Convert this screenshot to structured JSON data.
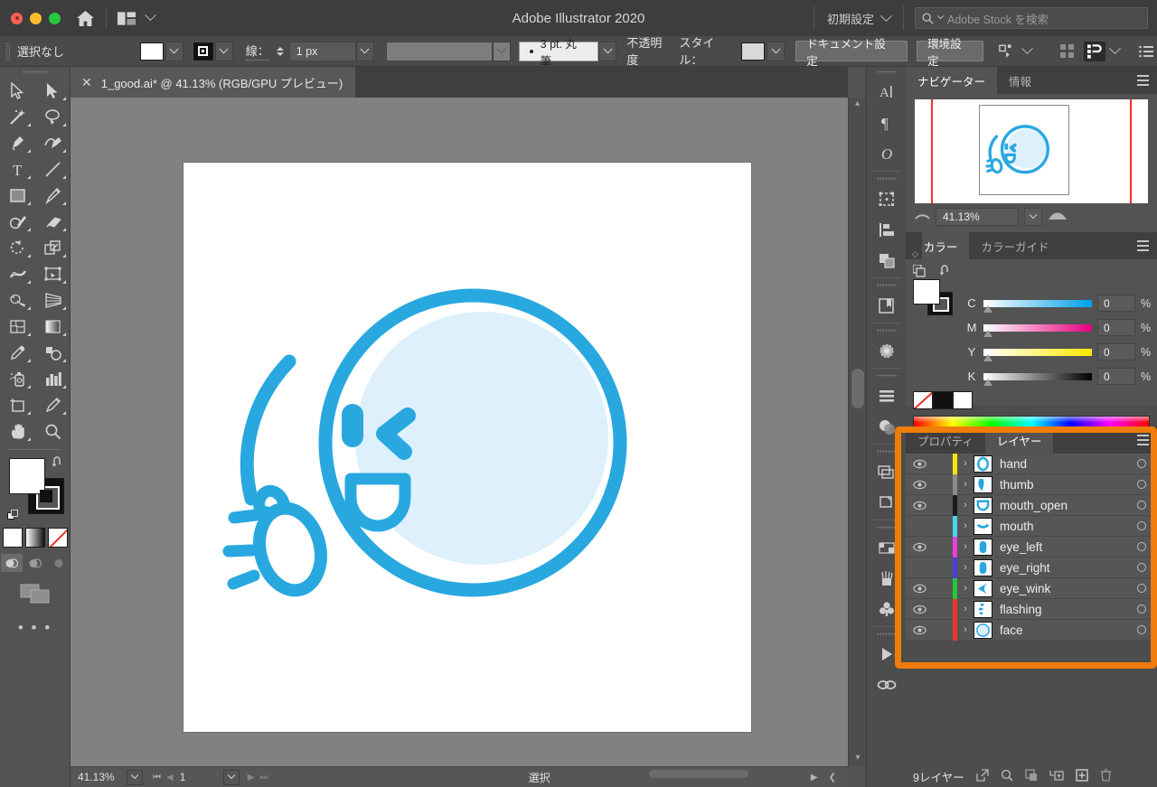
{
  "titlebar": {
    "app_title": "Adobe Illustrator 2020",
    "home_icon": "home-icon",
    "arrange_icon": "arrange-documents-icon",
    "workspace": "初期設定",
    "search_placeholder": "Adobe Stock を検索",
    "search_icon": "search-icon"
  },
  "controlbar": {
    "selection_status": "選択なし",
    "fill_label": "fill-swatch",
    "stroke_label": "stroke-swatch",
    "stroke_text": "線：",
    "stroke_weight": "1 px",
    "brush_definition": "3 pt. 丸筆",
    "opacity_label": "不透明度",
    "style_label": "スタイル：",
    "document_setup": "ドキュメント設定",
    "preferences": "環境設定",
    "select_similar_icon": "select-similar-icon",
    "align_icon": "align-icon",
    "arrange_icon": "arrange-icon",
    "options_icon": "options-list-icon"
  },
  "tools": [
    {
      "name": "selection-tool",
      "glyph": "arrow-outline"
    },
    {
      "name": "direct-selection-tool",
      "glyph": "arrow-solid"
    },
    {
      "name": "magic-wand-tool",
      "glyph": "wand"
    },
    {
      "name": "lasso-tool",
      "glyph": "lasso"
    },
    {
      "name": "pen-tool",
      "glyph": "pen"
    },
    {
      "name": "curvature-tool",
      "glyph": "curvature"
    },
    {
      "name": "type-tool",
      "glyph": "T"
    },
    {
      "name": "line-segment-tool",
      "glyph": "line"
    },
    {
      "name": "rectangle-tool",
      "glyph": "rect"
    },
    {
      "name": "paintbrush-tool",
      "glyph": "brush"
    },
    {
      "name": "shaper-tool",
      "glyph": "shaper"
    },
    {
      "name": "eraser-tool",
      "glyph": "eraser"
    },
    {
      "name": "rotate-tool",
      "glyph": "rotate"
    },
    {
      "name": "scale-tool",
      "glyph": "scale"
    },
    {
      "name": "width-tool",
      "glyph": "width"
    },
    {
      "name": "free-transform-tool",
      "glyph": "freetransform"
    },
    {
      "name": "shape-builder-tool",
      "glyph": "shapebuilder"
    },
    {
      "name": "perspective-grid-tool",
      "glyph": "perspective"
    },
    {
      "name": "mesh-tool",
      "glyph": "mesh"
    },
    {
      "name": "gradient-tool",
      "glyph": "gradient"
    },
    {
      "name": "eyedropper-tool",
      "glyph": "eyedropper"
    },
    {
      "name": "blend-tool",
      "glyph": "blend"
    },
    {
      "name": "symbol-sprayer-tool",
      "glyph": "sprayer"
    },
    {
      "name": "column-graph-tool",
      "glyph": "graph"
    },
    {
      "name": "artboard-tool",
      "glyph": "artboard"
    },
    {
      "name": "slice-tool",
      "glyph": "slice"
    },
    {
      "name": "hand-tool",
      "glyph": "hand"
    },
    {
      "name": "zoom-tool",
      "glyph": "zoom"
    }
  ],
  "document_tab": {
    "close_icon": "close-icon",
    "title": "1_good.ai* @ 41.13% (RGB/GPU プレビュー)"
  },
  "statusbar": {
    "zoom": "41.13%",
    "page": "1",
    "mode": "選択",
    "first_icon": "first-page-icon",
    "prev_icon": "prev-page-icon",
    "next_icon": "next-page-icon",
    "last_icon": "last-page-icon"
  },
  "icondock": [
    {
      "name": "character-panel-icon",
      "glyph": "A"
    },
    {
      "name": "paragraph-panel-icon",
      "glyph": "¶"
    },
    {
      "name": "opentype-panel-icon",
      "glyph": "O"
    },
    {
      "name": "transform-panel-icon",
      "glyph": "transform"
    },
    {
      "name": "align-panel-icon",
      "glyph": "align"
    },
    {
      "name": "pathfinder-panel-icon",
      "glyph": "pathfinder"
    },
    {
      "name": "libraries-panel-icon",
      "glyph": "libraries"
    },
    {
      "name": "gradient-panel-icon",
      "glyph": "gradient"
    },
    {
      "name": "stroke-panel-icon",
      "glyph": "stroke"
    },
    {
      "name": "transparency-panel-icon",
      "glyph": "transparency"
    },
    {
      "name": "appearance-panel-icon",
      "glyph": "appearance"
    },
    {
      "name": "graphic-styles-panel-icon",
      "glyph": "graphicstyles"
    },
    {
      "name": "swatches-panel-icon",
      "glyph": "swatches"
    },
    {
      "name": "brushes-panel-icon",
      "glyph": "brushes"
    },
    {
      "name": "symbols-panel-icon",
      "glyph": "symbols"
    },
    {
      "name": "actions-panel-icon",
      "glyph": "play"
    },
    {
      "name": "links-panel-icon",
      "glyph": "links"
    }
  ],
  "navigator": {
    "tabs": [
      {
        "label": "ナビゲーター",
        "active": true
      },
      {
        "label": "情報",
        "active": false
      }
    ],
    "menu_icon": "panel-menu-icon",
    "zoom": "41.13%",
    "zoom_out_icon": "zoom-out-icon",
    "zoom_in_icon": "zoom-in-icon"
  },
  "color": {
    "tabs": [
      {
        "label": "カラー",
        "active": true
      },
      {
        "label": "カラーガイド",
        "active": false
      }
    ],
    "menu_icon": "panel-menu-icon",
    "sliders": [
      {
        "letter": "C",
        "value": "0",
        "unit": "%",
        "color": "#00a0e9"
      },
      {
        "letter": "M",
        "value": "0",
        "unit": "%",
        "color": "#e4007f"
      },
      {
        "letter": "Y",
        "value": "0",
        "unit": "%",
        "color": "#ffe800"
      },
      {
        "letter": "K",
        "value": "0",
        "unit": "%",
        "color": "#000000"
      }
    ],
    "swatch_none": "none-swatch",
    "swatch_black": "black-swatch",
    "swatch_white": "white-swatch"
  },
  "layers": {
    "tabs": [
      {
        "label": "プロパティ",
        "active": false
      },
      {
        "label": "レイヤー",
        "active": true
      }
    ],
    "menu_icon": "panel-menu-icon",
    "highlight_color": "#f07c0a",
    "rows": [
      {
        "name": "hand",
        "visible": true,
        "color": "#f2e900",
        "thumb": "hand"
      },
      {
        "name": "thumb",
        "visible": true,
        "color": "#8a8a8a",
        "thumb": "thumb"
      },
      {
        "name": "mouth_open",
        "visible": true,
        "color": "#1a1a1a",
        "thumb": "mouth_open"
      },
      {
        "name": "mouth",
        "visible": false,
        "color": "#4cd4e8",
        "thumb": "mouth"
      },
      {
        "name": "eye_left",
        "visible": true,
        "color": "#e741d8",
        "thumb": "eye_left"
      },
      {
        "name": "eye_right",
        "visible": false,
        "color": "#4a3fd6",
        "thumb": "eye_right"
      },
      {
        "name": "eye_wink",
        "visible": true,
        "color": "#22c636",
        "thumb": "eye_wink"
      },
      {
        "name": "flashing",
        "visible": true,
        "color": "#f2322f",
        "thumb": "flashing"
      },
      {
        "name": "face",
        "visible": true,
        "color": "#f2322f",
        "thumb": "face"
      }
    ],
    "footer": {
      "count": "9レイヤー",
      "icons": [
        {
          "name": "locate-object-icon"
        },
        {
          "name": "search-layer-icon"
        },
        {
          "name": "make-clipping-mask-icon"
        },
        {
          "name": "create-sublayer-icon"
        },
        {
          "name": "create-new-layer-icon"
        },
        {
          "name": "delete-selection-icon"
        }
      ]
    }
  },
  "artwork": {
    "stroke_color": "#29a8e0",
    "face_fill": "#ddf0fb",
    "description": "winking smiley face with hand and flashing lines"
  }
}
